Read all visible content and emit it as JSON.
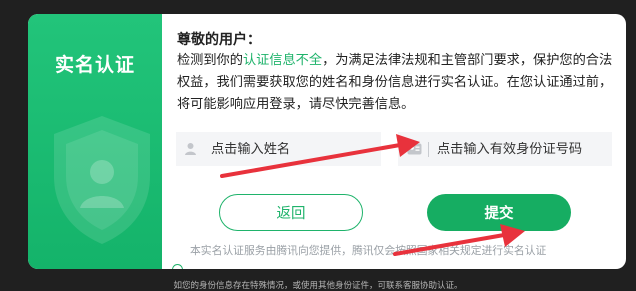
{
  "modal": {
    "left_title": "实名认证",
    "greeting": "尊敬的用户：",
    "desc_prefix": "检测到你的",
    "desc_highlight": "认证信息不全",
    "desc_suffix": "，为满足法律法规和主管部门要求，保护您的合法权益，我们需要获取您的姓名和身份信息进行实名认证。在您认证通过前，将可能影响应用登录，请尽快完善信息。",
    "name_input": {
      "placeholder": "点击输入姓名",
      "value": "",
      "icon": "person-icon"
    },
    "id_input": {
      "placeholder": "点击输入有效身份证号码",
      "value": "",
      "icon": "id-card-icon"
    },
    "back_button": "返回",
    "submit_button": "提交",
    "notice": "本实名认证服务由腾讯向您提供，腾讯仅会按照国家相关规定进行实名认证"
  },
  "bottom_tip": "如您的身份信息存在特殊情况，或使用其他身份证件，可联系客服协助认证。",
  "colors": {
    "accent": "#1fb36b",
    "panel": "#14b36a",
    "arrow": "#e8323c"
  }
}
